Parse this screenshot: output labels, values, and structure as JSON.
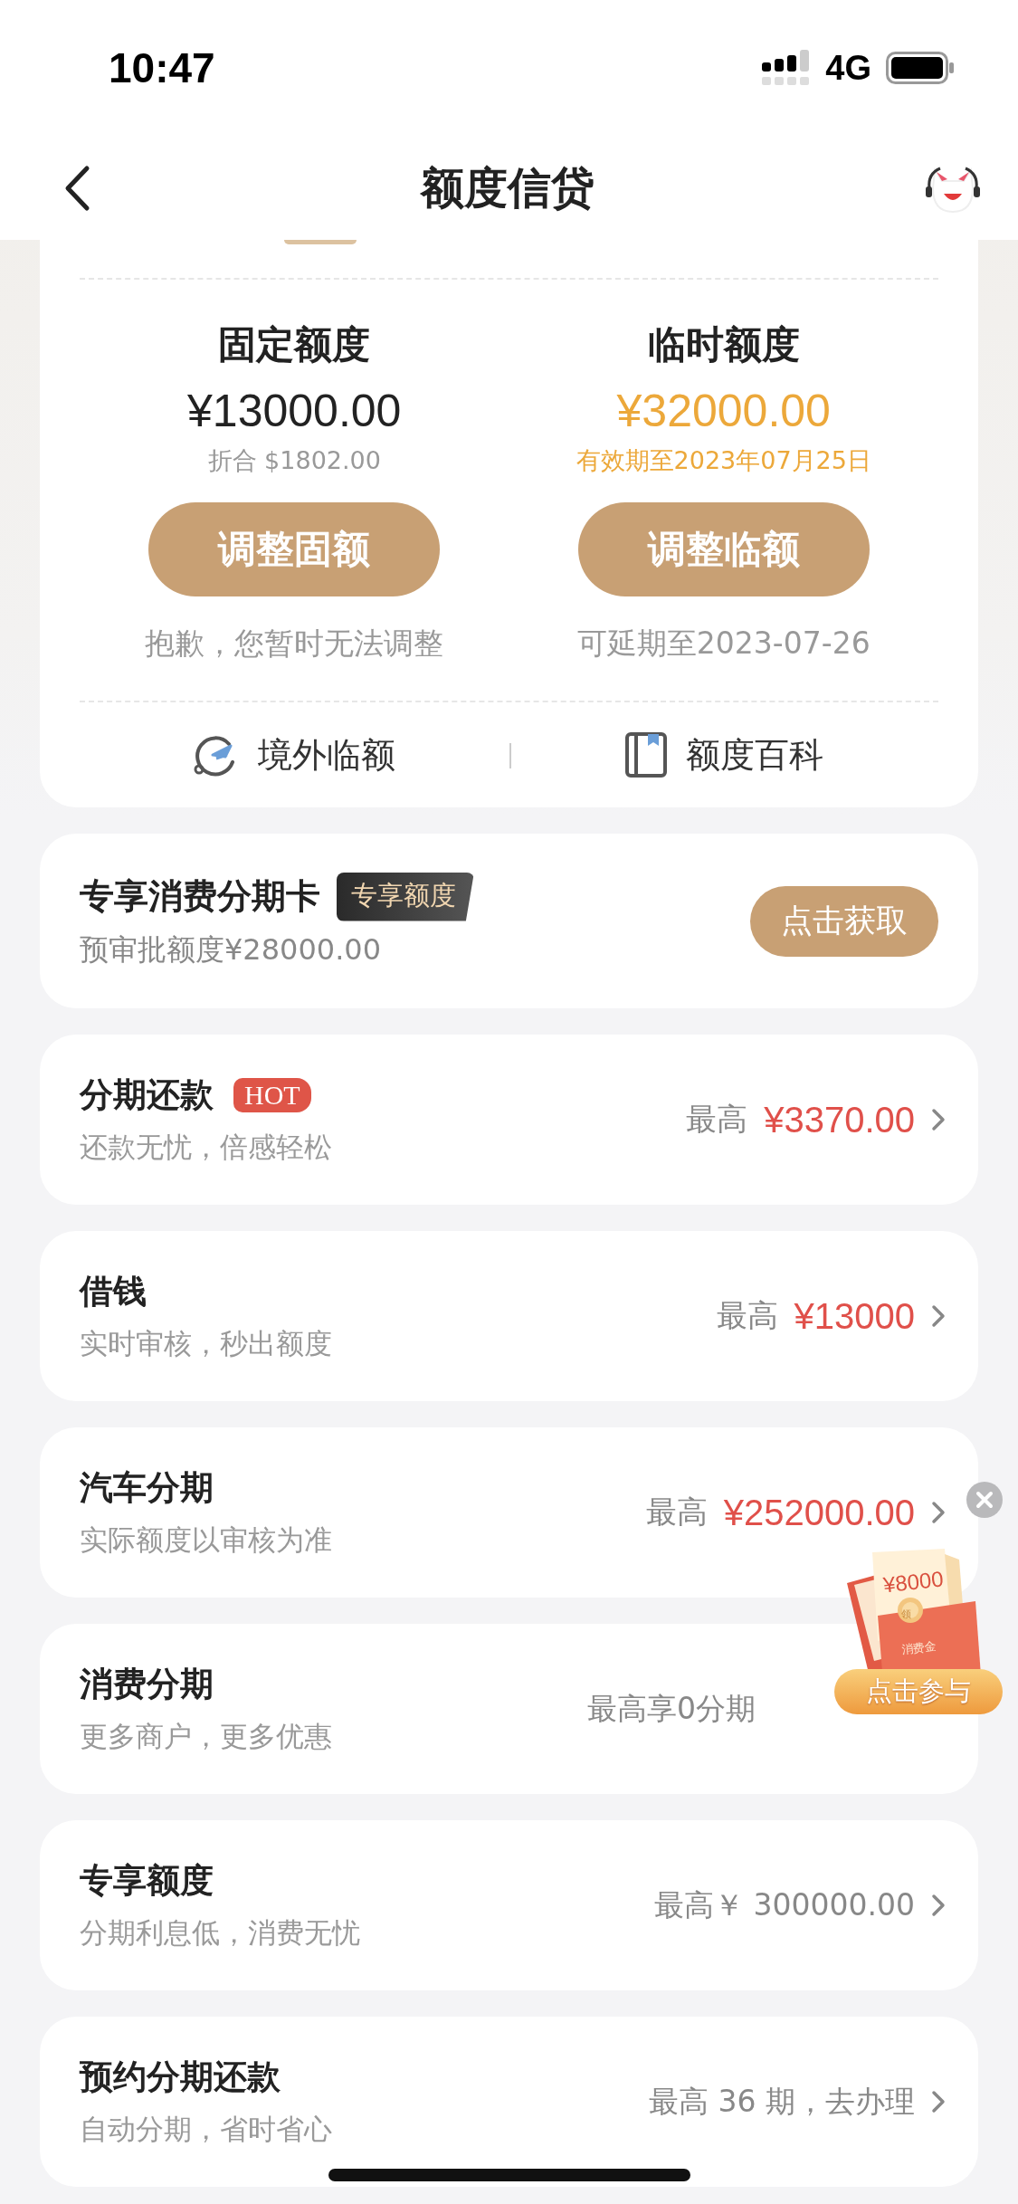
{
  "status_bar": {
    "time": "10:47",
    "network": "4G"
  },
  "nav": {
    "title": "额度信贷"
  },
  "quota": {
    "columns": [
      {
        "title": "固定额度",
        "amount": "¥13000.00",
        "note": "折合 $1802.00",
        "highlight": false,
        "button": "调整固额",
        "hint": "抱歉，您暂时无法调整"
      },
      {
        "title": "临时额度",
        "amount": "¥32000.00",
        "note": "有效期至2023年07月25日",
        "highlight": true,
        "button": "调整临额",
        "hint": "可延期至2023-07-26"
      }
    ],
    "links": [
      {
        "kind": "plane",
        "label": "境外临额"
      },
      {
        "kind": "book",
        "label": "额度百科"
      }
    ]
  },
  "promo": {
    "title": "专享消费分期卡",
    "badge": "专享额度",
    "subtitle": "预审批额度¥28000.00",
    "button": "点击获取"
  },
  "services": [
    {
      "kind": "amount",
      "title": "分期还款",
      "tag": "HOT",
      "subtitle": "还款无忧，倍感轻松",
      "prefix": "最高",
      "value": "¥3370.00",
      "chevron": true
    },
    {
      "kind": "amount",
      "title": "借钱",
      "subtitle": "实时审核，秒出额度",
      "prefix": "最高",
      "value": "¥13000",
      "chevron": true
    },
    {
      "kind": "amount",
      "title": "汽车分期",
      "subtitle": "实际额度以审核为准",
      "prefix": "最高",
      "value": "¥252000.00",
      "chevron": true
    },
    {
      "kind": "text",
      "title": "消费分期",
      "subtitle": "更多商户，更多优惠",
      "detail": "最高享0分期",
      "chevron": false
    },
    {
      "kind": "text",
      "title": "专享额度",
      "subtitle": "分期利息低，消费无忧",
      "detail": "最高￥ 300000.00",
      "chevron": true
    },
    {
      "kind": "text",
      "title": "预约分期还款",
      "subtitle": "自动分期，省时省心",
      "detail": "最高 36 期，去办理",
      "chevron": true
    }
  ],
  "float": {
    "amount": "¥8000",
    "coin": "领",
    "label": "消费金",
    "button": "点击参与"
  }
}
